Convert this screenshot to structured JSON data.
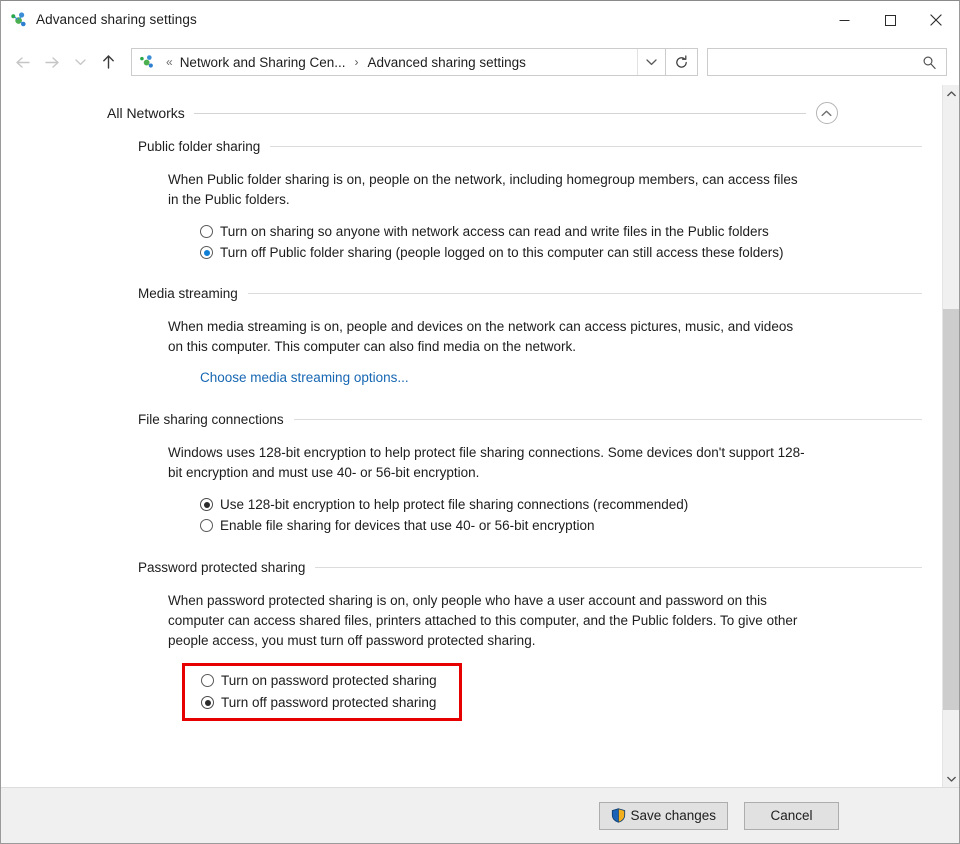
{
  "window": {
    "title": "Advanced sharing settings",
    "icon": "network-sharing-icon",
    "minimize_label": "Minimize",
    "maximize_label": "Maximize",
    "close_label": "Close"
  },
  "navbar": {
    "back_label": "Back",
    "forward_label": "Forward",
    "recent_label": "Recent locations",
    "up_label": "Up",
    "address_overflow": "«",
    "breadcrumbs": [
      "Network and Sharing Cen...",
      "Advanced sharing settings"
    ],
    "separator": "›",
    "dropdown_label": "Previous locations",
    "refresh_label": "Refresh",
    "search": {
      "value": "",
      "placeholder": "",
      "icon": "search-icon"
    }
  },
  "content": {
    "group": {
      "label": "All Networks",
      "collapse_icon": "chevron-up-icon"
    },
    "sections": [
      {
        "id": "public-folder-sharing",
        "heading": "Public folder sharing",
        "description": "When Public folder sharing is on, people on the network, including homegroup members, can access files in the Public folders.",
        "options": [
          {
            "label": "Turn on sharing so anyone with network access can read and write files in the Public folders",
            "checked": false,
            "style": "blue"
          },
          {
            "label": "Turn off Public folder sharing (people logged on to this computer can still access these folders)",
            "checked": true,
            "style": "blue"
          }
        ]
      },
      {
        "id": "media-streaming",
        "heading": "Media streaming",
        "description": "When media streaming is on, people and devices on the network can access pictures, music, and videos on this computer. This computer can also find media on the network.",
        "link": "Choose media streaming options...",
        "options": []
      },
      {
        "id": "file-sharing-connections",
        "heading": "File sharing connections",
        "description": "Windows uses 128-bit encryption to help protect file sharing connections. Some devices don't support 128-bit encryption and must use 40- or 56-bit encryption.",
        "options": [
          {
            "label": "Use 128-bit encryption to help protect file sharing connections (recommended)",
            "checked": true,
            "style": "dark"
          },
          {
            "label": "Enable file sharing for devices that use 40- or 56-bit encryption",
            "checked": false,
            "style": "dark"
          }
        ]
      },
      {
        "id": "password-protected-sharing",
        "heading": "Password protected sharing",
        "description": "When password protected sharing is on, only people who have a user account and password on this computer can access shared files, printers attached to this computer, and the Public folders. To give other people access, you must turn off password protected sharing.",
        "highlighted": true,
        "highlight_color": "#e60000",
        "options": [
          {
            "label": "Turn on password protected sharing",
            "checked": false,
            "style": "dark"
          },
          {
            "label": "Turn off password protected sharing",
            "checked": true,
            "style": "dark"
          }
        ]
      }
    ]
  },
  "scrollbar": {
    "up_label": "Scroll up",
    "down_label": "Scroll down",
    "thumb_label": "Scroll thumb"
  },
  "footer": {
    "save_label": "Save changes",
    "save_icon": "uac-shield-icon",
    "cancel_label": "Cancel"
  },
  "colors": {
    "accent_blue": "#0f7fd6",
    "link_blue": "#1767b3",
    "highlight_red": "#e60000",
    "chrome_gray": "#f0f0f0"
  }
}
